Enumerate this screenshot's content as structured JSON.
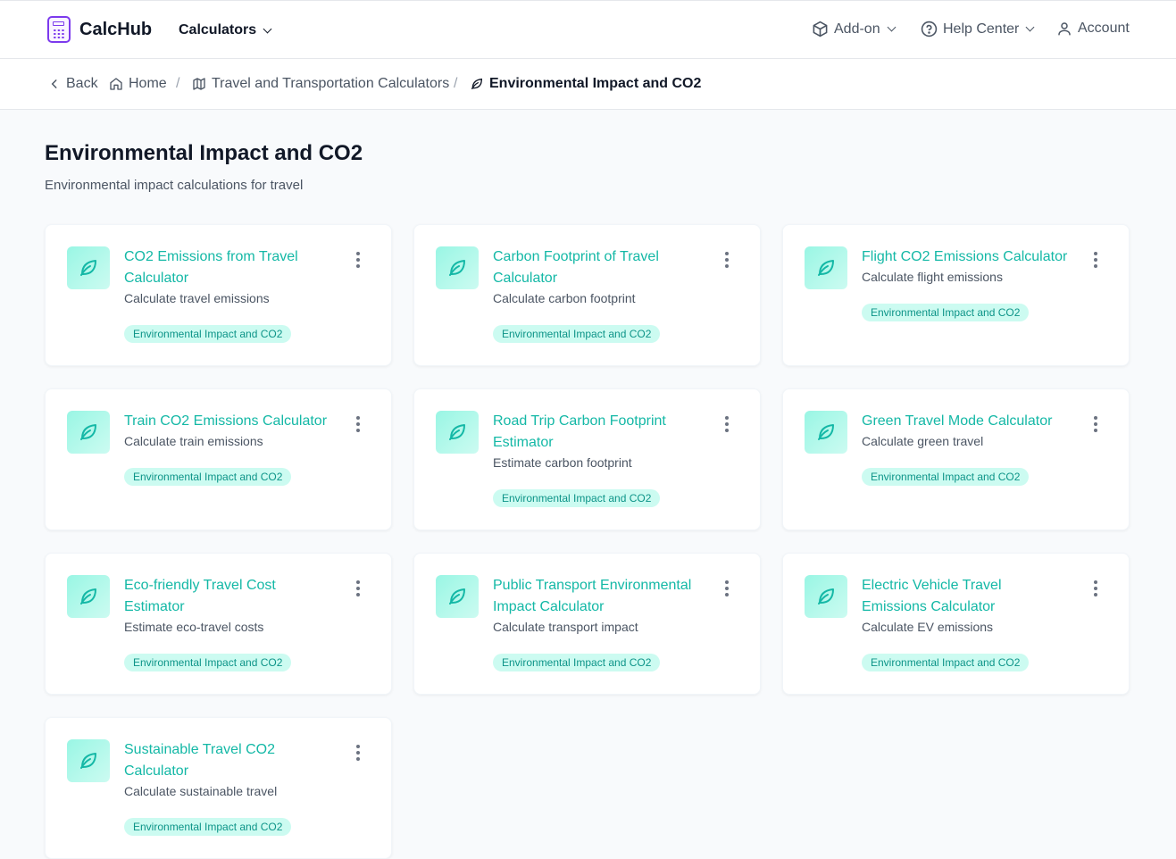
{
  "header": {
    "brand": "CalcHub",
    "calculators_label": "Calculators",
    "addon_label": "Add-on",
    "help_label": "Help Center",
    "account_label": "Account"
  },
  "breadcrumb": {
    "back": "Back",
    "home": "Home",
    "category": "Travel and Transportation Calculators",
    "current": "Environmental Impact and CO2"
  },
  "page": {
    "title": "Environmental Impact and CO2",
    "subtitle": "Environmental impact calculations for travel"
  },
  "colors": {
    "accent": "#14b8a6",
    "badge_bg": "#ccfbf1",
    "badge_text": "#0d9488",
    "brand": "#7c3aed"
  },
  "cards": [
    {
      "title_lines": [
        "CO2 Emissions from Travel",
        "Calculator"
      ],
      "desc": "Calculate travel emissions",
      "badge": "Environmental Impact and CO2",
      "icon": "leaf-icon"
    },
    {
      "title_lines": [
        "Carbon Footprint of Travel",
        "Calculator"
      ],
      "desc": "Calculate carbon footprint",
      "badge": "Environmental Impact and CO2",
      "icon": "leaf-icon"
    },
    {
      "title_lines": [
        "Flight CO2 Emissions Calculator"
      ],
      "desc": "Calculate flight emissions",
      "badge": "Environmental Impact and CO2",
      "icon": "leaf-icon"
    },
    {
      "title_lines": [
        "Train CO2 Emissions Calculator"
      ],
      "desc": "Calculate train emissions",
      "badge": "Environmental Impact and CO2",
      "icon": "leaf-icon"
    },
    {
      "title_lines": [
        "Road Trip Carbon Footprint",
        "Estimator"
      ],
      "desc": "Estimate carbon footprint",
      "badge": "Environmental Impact and CO2",
      "icon": "leaf-icon"
    },
    {
      "title_lines": [
        "Green Travel Mode Calculator"
      ],
      "desc": "Calculate green travel",
      "badge": "Environmental Impact and CO2",
      "icon": "leaf-icon"
    },
    {
      "title_lines": [
        "Eco-friendly Travel Cost",
        "Estimator"
      ],
      "desc": "Estimate eco-travel costs",
      "badge": "Environmental Impact and CO2",
      "icon": "leaf-icon"
    },
    {
      "title_lines": [
        "Public Transport Environmental",
        "Impact Calculator"
      ],
      "desc": "Calculate transport impact",
      "badge": "Environmental Impact and CO2",
      "icon": "leaf-icon"
    },
    {
      "title_lines": [
        "Electric Vehicle Travel",
        "Emissions Calculator"
      ],
      "desc": "Calculate EV emissions",
      "badge": "Environmental Impact and CO2",
      "icon": "leaf-icon"
    },
    {
      "title_lines": [
        "Sustainable Travel CO2",
        "Calculator"
      ],
      "desc": "Calculate sustainable travel",
      "badge": "Environmental Impact and CO2",
      "icon": "leaf-icon"
    }
  ]
}
